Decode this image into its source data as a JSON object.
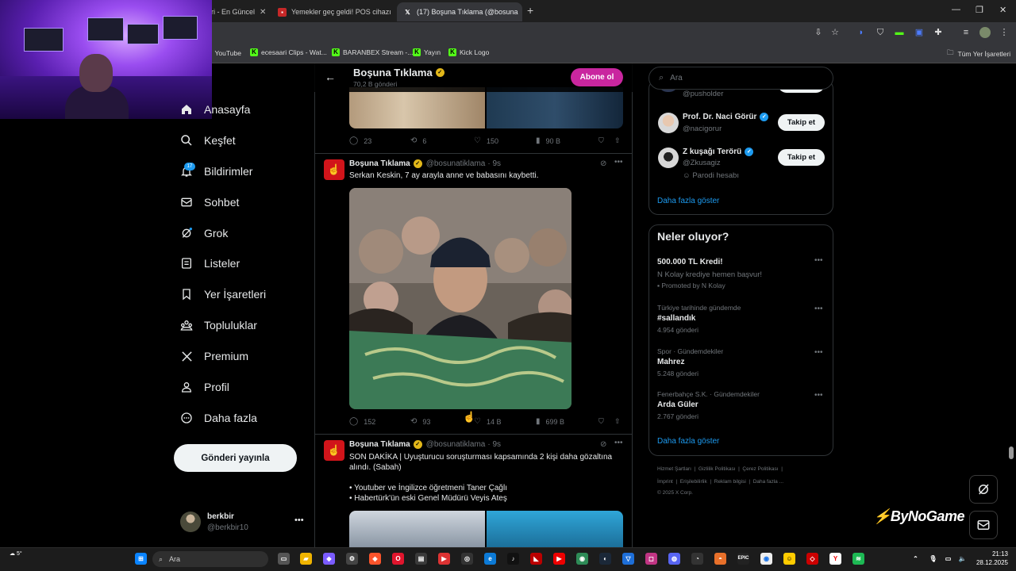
{
  "browser": {
    "tabs": [
      {
        "title": "ri - En Güncel",
        "icon": "news-icon"
      },
      {
        "title": "Yemekler geç geldi! POS cihazı",
        "icon": "news-icon"
      },
      {
        "title": "(17) Boşuna Tıklama (@bosuna",
        "icon": "x-logo-icon"
      }
    ],
    "bookmarks": [
      {
        "label": "YouTube"
      },
      {
        "label": "ecesaari Clips - Wat..."
      },
      {
        "label": "BARANBEX Stream -..."
      },
      {
        "label": "Yayın"
      },
      {
        "label": "Kick Logo"
      }
    ],
    "all_bookmarks": "Tüm Yer İşaretleri"
  },
  "nav": {
    "items": [
      {
        "label": "Anasayfa",
        "icon": "home-icon"
      },
      {
        "label": "Keşfet",
        "icon": "search-icon"
      },
      {
        "label": "Bildirimler",
        "icon": "bell-icon"
      },
      {
        "label": "Sohbet",
        "icon": "mail-icon"
      },
      {
        "label": "Grok",
        "icon": "grok-icon"
      },
      {
        "label": "Listeler",
        "icon": "list-icon"
      },
      {
        "label": "Yer İşaretleri",
        "icon": "bookmark-icon"
      },
      {
        "label": "Topluluklar",
        "icon": "communities-icon"
      },
      {
        "label": "Premium",
        "icon": "x-logo-icon"
      },
      {
        "label": "Profil",
        "icon": "person-icon"
      },
      {
        "label": "Daha fazla",
        "icon": "more-circle-icon"
      }
    ],
    "notifications_badge": "17",
    "post_button": "Gönderi yayınla",
    "user": {
      "name": "berkbir",
      "handle": "@berkbir10"
    }
  },
  "timeline": {
    "header": {
      "title": "Boşuna Tıklama",
      "subtitle": "70,2 B gönderi",
      "subscribe": "Abone ol"
    },
    "prev_actions": {
      "replies": "23",
      "reposts": "6",
      "likes": "150",
      "views": "90 B"
    },
    "tweets": [
      {
        "name": "Boşuna Tıklama",
        "handle": "@bosunatiklama",
        "time": "· 9s",
        "text": "Serkan Keskin, 7 ay arayla anne ve babasını kaybetti.",
        "actions": {
          "replies": "152",
          "reposts": "93",
          "likes": "14 B",
          "views": "699 B"
        }
      },
      {
        "name": "Boşuna Tıklama",
        "handle": "@bosunatiklama",
        "time": "· 9s",
        "text_lines": [
          "SON DAKİKA | Uyuşturucu soruşturması kapsamında 2 kişi daha gözaltına",
          "alındı. (Sabah)",
          "",
          "• Youtuber ve İngilizce öğretmeni Taner Çağlı",
          "• Habertürk'ün eski Genel Müdürü Veyis Ateş"
        ]
      }
    ]
  },
  "sidebar": {
    "search_placeholder": "Ara",
    "who_to_follow": [
      {
        "name": "",
        "handle": "@pusholder"
      },
      {
        "name": "Prof. Dr. Naci Görür",
        "handle": "@nacigorur",
        "button": "Takip et"
      },
      {
        "name": "Z kuşağı Terörü",
        "handle": "@Zkusagiz",
        "note": "Parodi hesabı",
        "button": "Takip et"
      }
    ],
    "show_more": "Daha fazla göster",
    "trends_title": "Neler oluyor?",
    "trends": [
      {
        "context": "",
        "name": "500.000 TL Kredi!",
        "sub": "N Kolay krediye hemen başvur!",
        "promo": "Promoted by N Kolay"
      },
      {
        "context": "Türkiye tarihinde gündemde",
        "name": "#sallandık",
        "sub": "4.954 gönderi"
      },
      {
        "context": "Spor · Gündemdekiler",
        "name": "Mahrez",
        "sub": "5.248 gönderi"
      },
      {
        "context": "Fenerbahçe S.K. · Gündemdekiler",
        "name": "Arda Güler",
        "sub": "2.767 gönderi"
      }
    ],
    "trends_more": "Daha fazla göster",
    "footer": {
      "line1": [
        "Hizmet Şartları",
        "Gizlilik Politikası",
        "Çerez Politikası"
      ],
      "line2": [
        "İmprint",
        "Erişilebilirlik",
        "Reklam bilgisi",
        "Daha fazla ..."
      ],
      "copyright": "© 2025 X Corp."
    }
  },
  "overlay": {
    "brand": "ByNoGame"
  },
  "taskbar": {
    "search": "Ara",
    "weather": "5°",
    "time": "21:13",
    "date": "28.12.2025"
  },
  "colors": {
    "accent": "#1d9bf0",
    "subscribe": "#c9269f",
    "verified_gold": "#e2b719",
    "background": "#000000"
  }
}
